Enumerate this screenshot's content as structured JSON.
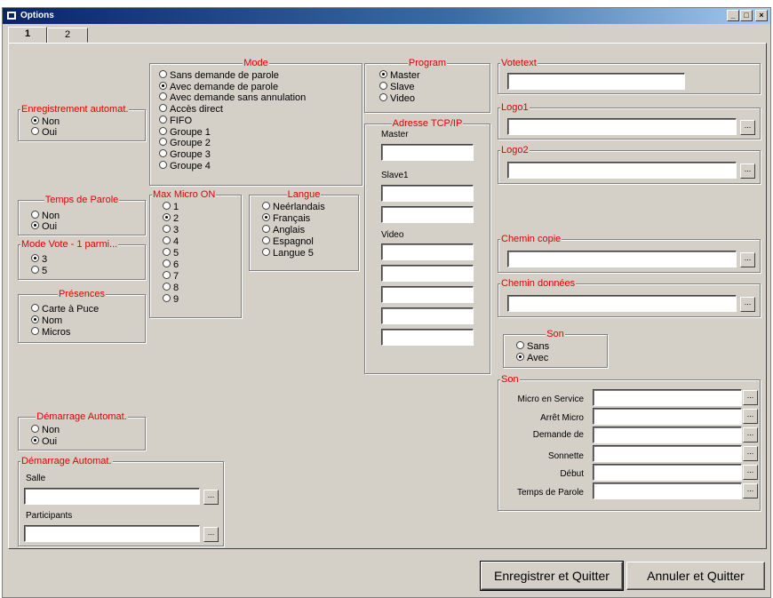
{
  "window": {
    "title": "Options"
  },
  "titlebar_buttons": {
    "minimize": "_",
    "maximize": "□",
    "close": "×"
  },
  "tabs": [
    "1",
    "2"
  ],
  "mode": {
    "title": "Mode",
    "options": [
      "Sans demande de parole",
      "Avec demande de parole",
      "Avec demande sans annulation",
      "Accès direct",
      "FIFO",
      "Groupe 1",
      "Groupe 2",
      "Groupe 3",
      "Groupe 4"
    ],
    "selected": 1
  },
  "program": {
    "title": "Program",
    "options": [
      "Master",
      "Slave",
      "Video"
    ],
    "selected": 0
  },
  "enregistrement": {
    "title": "Enregistrement automat.",
    "options": [
      "Non",
      "Oui"
    ],
    "selected": 0
  },
  "temps_parole": {
    "title": "Temps de Parole",
    "options": [
      "Non",
      "Oui"
    ],
    "selected": 1
  },
  "mode_vote": {
    "title": "Mode Vote - 1 parmi...",
    "options": [
      "3",
      "5"
    ],
    "selected": 0
  },
  "presences": {
    "title": "Présences",
    "options": [
      "Carte à Puce",
      "Nom",
      "Micros"
    ],
    "selected": 1
  },
  "max_micro": {
    "title": "Max Micro ON",
    "options": [
      "1",
      "2",
      "3",
      "4",
      "5",
      "6",
      "7",
      "8",
      "9"
    ],
    "selected": 1
  },
  "langue": {
    "title": "Langue",
    "options": [
      "Neérlandais",
      "Français",
      "Anglais",
      "Espagnol",
      "Langue 5"
    ],
    "selected": 1
  },
  "adresse": {
    "title": "Adresse TCP/IP",
    "master_label": "Master",
    "slave_label": "Slave1",
    "video_label": "Video"
  },
  "votetext": {
    "title": "Votetext"
  },
  "logo1": {
    "title": "Logo1"
  },
  "logo2": {
    "title": "Logo2"
  },
  "chemin_copie": {
    "title": "Chemin copie"
  },
  "chemin_donnees": {
    "title": "Chemin données"
  },
  "son_radio": {
    "title": "Son",
    "options": [
      "Sans",
      "Avec"
    ],
    "selected": 1
  },
  "son_files": {
    "title": "Son",
    "labels": [
      "Micro en Service",
      "Arrêt Micro",
      "Demande de",
      "Sonnette",
      "Début",
      "Temps de Parole"
    ]
  },
  "demarrage1": {
    "title": "Démarrage Automat.",
    "options": [
      "Non",
      "Oui"
    ],
    "selected": 1
  },
  "demarrage2": {
    "title": "Démarrage Automat.",
    "salle_label": "Salle",
    "participants_label": "Participants"
  },
  "browse_label": "...",
  "buttons": {
    "save": "Enregistrer et Quitter",
    "cancel": "Annuler et Quitter"
  }
}
